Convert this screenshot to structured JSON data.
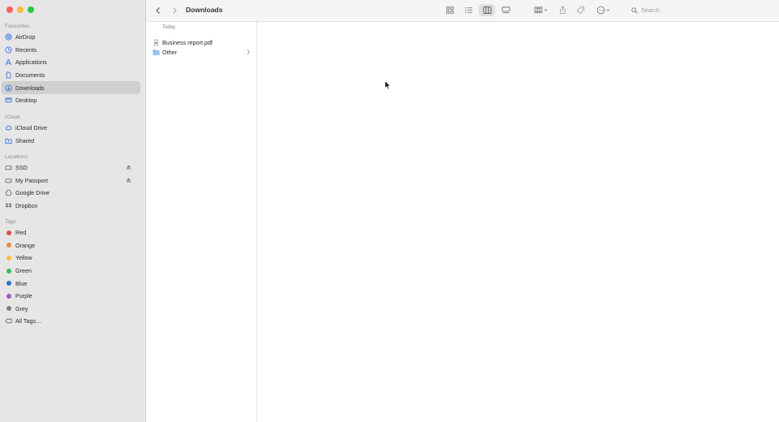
{
  "window": {
    "title": "Downloads"
  },
  "sidebar": {
    "sections": [
      {
        "header": "Favourites",
        "items": [
          {
            "label": "AirDrop",
            "icon": "airdrop-icon"
          },
          {
            "label": "Recents",
            "icon": "clock-icon"
          },
          {
            "label": "Applications",
            "icon": "applications-icon"
          },
          {
            "label": "Documents",
            "icon": "document-icon"
          },
          {
            "label": "Downloads",
            "icon": "download-icon",
            "selected": true
          },
          {
            "label": "Desktop",
            "icon": "desktop-icon"
          }
        ]
      },
      {
        "header": "iCloud",
        "items": [
          {
            "label": "iCloud Drive",
            "icon": "cloud-icon"
          },
          {
            "label": "Shared",
            "icon": "shared-folder-icon"
          }
        ]
      },
      {
        "header": "Locations",
        "items": [
          {
            "label": "SSD",
            "icon": "drive-icon",
            "eject": true
          },
          {
            "label": "My Passport",
            "icon": "drive-icon",
            "eject": true
          },
          {
            "label": "Google Drive",
            "icon": "google-drive-icon"
          },
          {
            "label": "Dropbox",
            "icon": "dropbox-icon"
          }
        ]
      },
      {
        "header": "Tags",
        "items": [
          {
            "label": "Red",
            "color": "#e9493f"
          },
          {
            "label": "Orange",
            "color": "#f0883a"
          },
          {
            "label": "Yellow",
            "color": "#f4c431"
          },
          {
            "label": "Green",
            "color": "#3fb84a"
          },
          {
            "label": "Blue",
            "color": "#2e6fd8"
          },
          {
            "label": "Purple",
            "color": "#9a5bc8"
          },
          {
            "label": "Grey",
            "color": "#7f7f7f"
          },
          {
            "label": "All Tags…",
            "icon": "all-tags-icon"
          }
        ]
      }
    ]
  },
  "toolbar": {
    "search_placeholder": "Search",
    "view_modes": [
      "icon-view-icon",
      "list-view-icon",
      "column-view-icon",
      "gallery-view-icon"
    ],
    "active_view": "column-view-icon"
  },
  "column": {
    "header": "Today",
    "items": [
      {
        "label": "Business report.pdf",
        "icon": "pdf-file-icon",
        "is_folder": false
      },
      {
        "label": "Other",
        "icon": "folder-icon",
        "is_folder": true
      }
    ]
  },
  "colors": {
    "accent": "#2e6fd8",
    "sidebar_bg": "#e6e6e6",
    "selection_bg": "#cfcfcf"
  }
}
